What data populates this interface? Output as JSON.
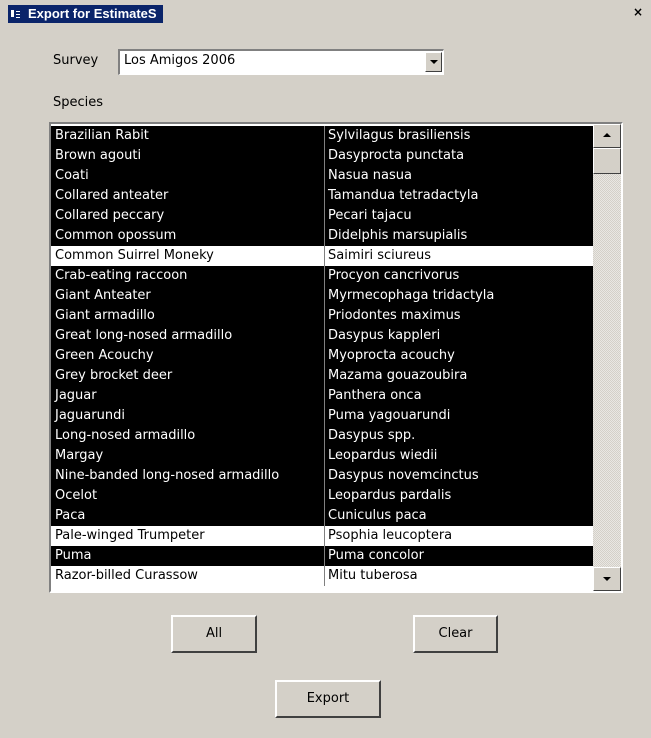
{
  "window": {
    "title": "Export for EstimateS",
    "close_glyph": "×"
  },
  "survey": {
    "label": "Survey",
    "selected": "Los Amigos 2006"
  },
  "species": {
    "label": "Species",
    "rows": [
      {
        "common": "Brazilian Rabit",
        "scientific": "Sylvilagus brasiliensis",
        "selected": true
      },
      {
        "common": "Brown agouti",
        "scientific": "Dasyprocta punctata",
        "selected": true
      },
      {
        "common": "Coati",
        "scientific": "Nasua nasua",
        "selected": true
      },
      {
        "common": "Collared anteater",
        "scientific": "Tamandua tetradactyla",
        "selected": true
      },
      {
        "common": "Collared peccary",
        "scientific": "Pecari tajacu",
        "selected": true
      },
      {
        "common": "Common opossum",
        "scientific": "Didelphis marsupialis",
        "selected": true
      },
      {
        "common": "Common Suirrel Moneky",
        "scientific": "Saimiri sciureus",
        "selected": false
      },
      {
        "common": "Crab-eating raccoon",
        "scientific": "Procyon cancrivorus",
        "selected": true
      },
      {
        "common": "Giant Anteater",
        "scientific": "Myrmecophaga tridactyla",
        "selected": true
      },
      {
        "common": "Giant armadillo",
        "scientific": "Priodontes maximus",
        "selected": true
      },
      {
        "common": "Great long-nosed armadillo",
        "scientific": "Dasypus kappleri",
        "selected": true
      },
      {
        "common": "Green Acouchy",
        "scientific": "Myoprocta acouchy",
        "selected": true
      },
      {
        "common": "Grey brocket deer",
        "scientific": "Mazama gouazoubira",
        "selected": true
      },
      {
        "common": "Jaguar",
        "scientific": "Panthera onca",
        "selected": true
      },
      {
        "common": "Jaguarundi",
        "scientific": "Puma yagouarundi",
        "selected": true
      },
      {
        "common": "Long-nosed armadillo",
        "scientific": "Dasypus spp.",
        "selected": true
      },
      {
        "common": "Margay",
        "scientific": "Leopardus wiedii",
        "selected": true
      },
      {
        "common": "Nine-banded long-nosed armadillo",
        "scientific": "Dasypus novemcinctus",
        "selected": true
      },
      {
        "common": "Ocelot",
        "scientific": "Leopardus pardalis",
        "selected": true
      },
      {
        "common": "Paca",
        "scientific": "Cuniculus paca",
        "selected": true
      },
      {
        "common": "Pale-winged Trumpeter",
        "scientific": "Psophia leucoptera",
        "selected": false
      },
      {
        "common": "Puma",
        "scientific": "Puma concolor",
        "selected": true
      },
      {
        "common": "Razor-billed Curassow",
        "scientific": "Mitu tuberosa",
        "selected": false
      }
    ]
  },
  "buttons": {
    "all": "All",
    "clear": "Clear",
    "export": "Export"
  },
  "colors": {
    "title_bar": "#0a246a",
    "dialog_bg": "#d4d0c8",
    "selection_bg": "#000000",
    "selection_fg": "#ffffff"
  }
}
